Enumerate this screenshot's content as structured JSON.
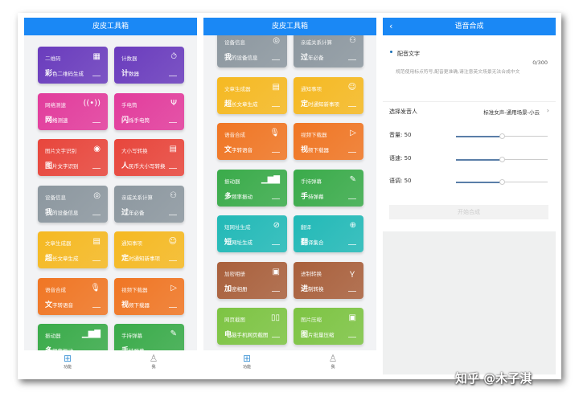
{
  "app_title": "皮皮工具箱",
  "tools": [
    {
      "title": "二维码",
      "sub_first": "彩",
      "sub_rest": "色二维码生成",
      "icon": "qr-code-icon",
      "glyph": "▦",
      "color": "#6a3cbd"
    },
    {
      "title": "计数器",
      "sub_first": "计",
      "sub_rest": "数器",
      "icon": "stopwatch-icon",
      "glyph": "⏱",
      "color": "#6a3cbd"
    },
    {
      "title": "网络测速",
      "sub_first": "网",
      "sub_rest": "络测速",
      "icon": "signal-icon",
      "glyph": "((•))",
      "color": "#e23c9c"
    },
    {
      "title": "手电筒",
      "sub_first": "闪",
      "sub_rest": "烁手电筒",
      "icon": "flashlight-icon",
      "glyph": "Ψ",
      "color": "#e23c9c"
    },
    {
      "title": "图片文字识别",
      "sub_first": "图",
      "sub_rest": "片文字识别",
      "icon": "eye-icon",
      "glyph": "◉",
      "color": "#e8463c"
    },
    {
      "title": "大小写转换",
      "sub_first": "人",
      "sub_rest": "民币大小写转换",
      "icon": "document-icon",
      "glyph": "▤",
      "color": "#e8463c"
    },
    {
      "title": "设备信息",
      "sub_first": "我",
      "sub_rest": "的设备信息",
      "icon": "device-icon",
      "glyph": "◎",
      "color": "#8c979f"
    },
    {
      "title": "亲戚关系计算",
      "sub_first": "过",
      "sub_rest": "年必备",
      "icon": "people-icon",
      "glyph": "⚇",
      "color": "#8c979f"
    },
    {
      "title": "文章生成器",
      "sub_first": "超",
      "sub_rest": "长文章生成",
      "icon": "article-icon",
      "glyph": "▤",
      "color": "#f5b922"
    },
    {
      "title": "通知事项",
      "sub_first": "定",
      "sub_rest": "时通知新事项",
      "icon": "notify-icon",
      "glyph": "☺",
      "color": "#f5b922"
    },
    {
      "title": "语音合成",
      "sub_first": "文",
      "sub_rest": "字转语音",
      "icon": "microphone-icon",
      "glyph": "🎙",
      "color": "#f07624"
    },
    {
      "title": "视频下载器",
      "sub_first": "视",
      "sub_rest": "频下载器",
      "icon": "play-icon",
      "glyph": "▷",
      "color": "#f07624"
    },
    {
      "title": "振动器",
      "sub_first": "多",
      "sub_rest": "频率振动",
      "icon": "bar-chart-icon",
      "glyph": "▁▆▇",
      "color": "#3aab4a"
    },
    {
      "title": "手持弹幕",
      "sub_first": "手",
      "sub_rest": "持弹幕",
      "icon": "pencil-icon",
      "glyph": "✎",
      "color": "#3aab4a"
    },
    {
      "title": "短网址生成",
      "sub_first": "短",
      "sub_rest": "网址生成",
      "icon": "link-icon",
      "glyph": "⊘",
      "color": "#22b9b7"
    },
    {
      "title": "翻译",
      "sub_first": "翻",
      "sub_rest": "译集合",
      "icon": "search-icon",
      "glyph": "⊕",
      "color": "#22b9b7"
    },
    {
      "title": "加密相册",
      "sub_first": "加",
      "sub_rest": "密相册",
      "icon": "album-icon",
      "glyph": "▣",
      "color": "#a9603c"
    },
    {
      "title": "进制转换",
      "sub_first": "进",
      "sub_rest": "制转换",
      "icon": "branch-icon",
      "glyph": "Ｙ",
      "color": "#a9603c"
    },
    {
      "title": "网页截图",
      "sub_first": "电",
      "sub_rest": "脑手机网页截图",
      "icon": "book-icon",
      "glyph": "▯▯",
      "color": "#7dc443"
    },
    {
      "title": "图片压缩",
      "sub_first": "图",
      "sub_rest": "片批量压缩",
      "icon": "compress-icon",
      "glyph": "▣",
      "color": "#7dc443"
    }
  ],
  "nav": {
    "home": "功能",
    "me": "我"
  },
  "tts": {
    "title": "语音合成",
    "text_label": "配音文字",
    "counter": "0/300",
    "placeholder": "规范使用标点符号,配音更准确,请注意英文场景无法合成中文",
    "voice_label": "选择发音人",
    "voice_value": "标准女声-通用场景-小云",
    "volume": {
      "label": "音量: 50",
      "value": 50
    },
    "speed": {
      "label": "语速: 50",
      "value": 50
    },
    "pitch": {
      "label": "语调: 50",
      "value": 50
    },
    "start_button": "开始合成"
  },
  "watermark": "知乎 @木子淇"
}
